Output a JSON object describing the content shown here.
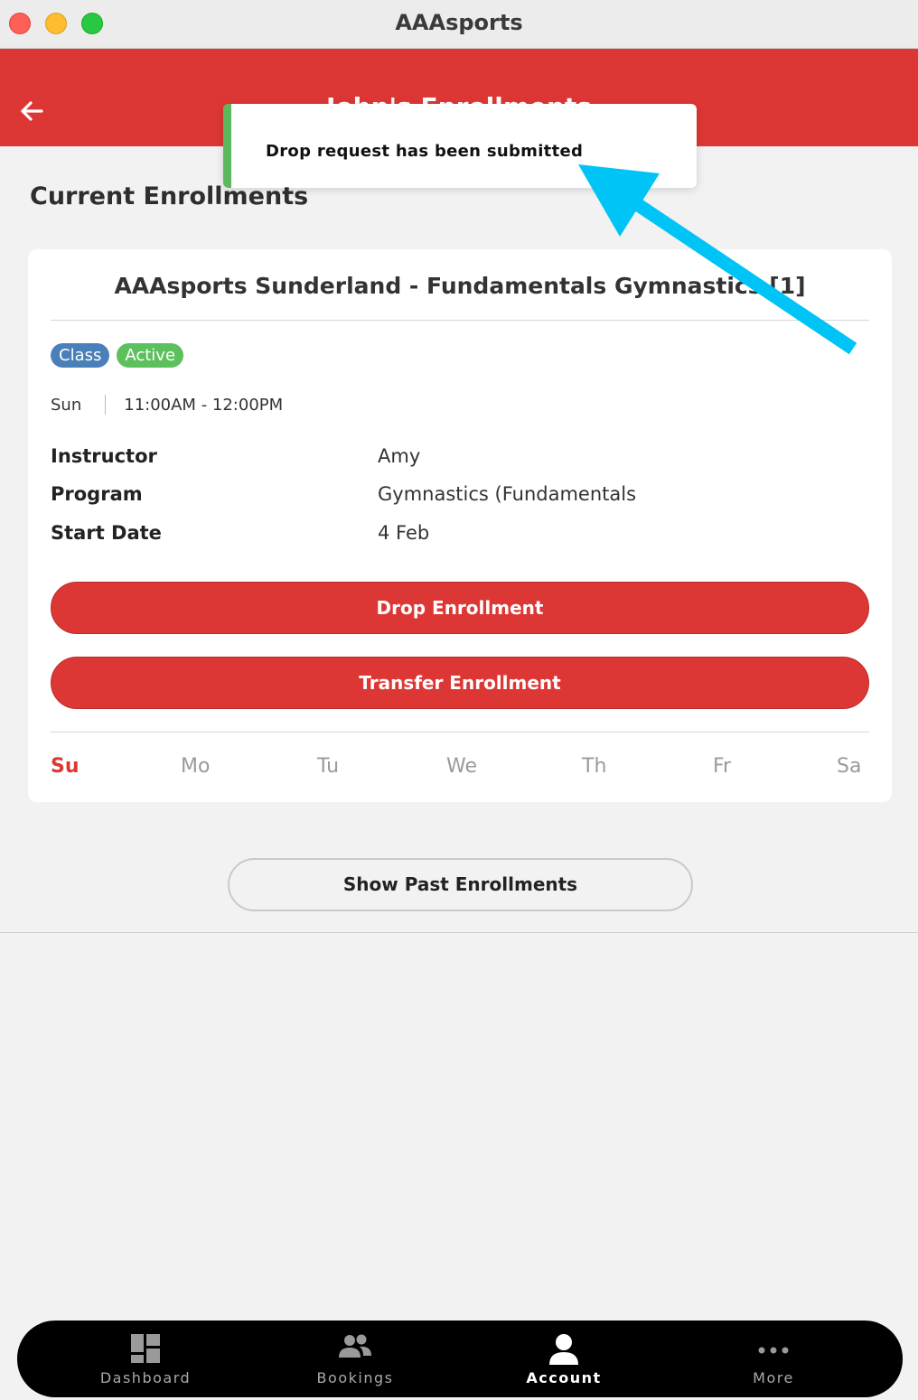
{
  "window": {
    "title": "AAAsports"
  },
  "header": {
    "title": "John's Enrollments"
  },
  "toast": {
    "message": "Drop request has been submitted"
  },
  "section": {
    "title": "Current Enrollments"
  },
  "enrollment": {
    "title": "AAAsports Sunderland - Fundamentals Gymnastics [1]",
    "badges": [
      "Class",
      "Active"
    ],
    "day": "Sun",
    "time": "11:00AM - 12:00PM",
    "details": [
      {
        "label": "Instructor",
        "value": "Amy"
      },
      {
        "label": "Program",
        "value": "Gymnastics (Fundamentals"
      },
      {
        "label": "Start Date",
        "value": "4 Feb"
      }
    ],
    "drop_label": "Drop Enrollment",
    "transfer_label": "Transfer Enrollment",
    "weekdays": [
      "Su",
      "Mo",
      "Tu",
      "We",
      "Th",
      "Fr",
      "Sa"
    ],
    "selected_day": "Su"
  },
  "past_label": "Show Past Enrollments",
  "nav": {
    "items": [
      {
        "label": "Dashboard",
        "icon": "dashboard-icon"
      },
      {
        "label": "Bookings",
        "icon": "people-icon"
      },
      {
        "label": "Account",
        "icon": "person-icon"
      },
      {
        "label": "More",
        "icon": "more-icon"
      }
    ],
    "selected": "Account"
  },
  "colors": {
    "brand_red": "#dd3735",
    "toast_accent": "#5cb85c",
    "annotation_arrow": "#00c4f5"
  }
}
